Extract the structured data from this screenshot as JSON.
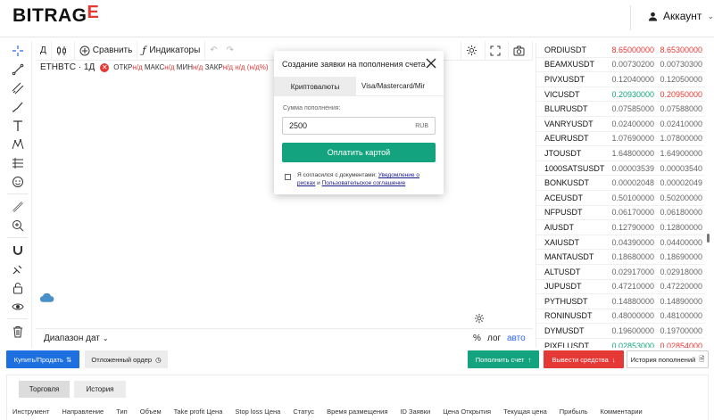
{
  "header": {
    "logo_main": "BITRAG",
    "logo_accent": "E",
    "account_label": "Аккаунт"
  },
  "toolbar": {
    "interval": "Д",
    "compare_label": "Сравнить",
    "indicators_label": "Индикаторы"
  },
  "legend": {
    "symbol": "ETHBTC · 1Д",
    "ohlc": [
      {
        "k": "ОТКР",
        "v": "н/д"
      },
      {
        "k": "МАКС",
        "v": "н/д"
      },
      {
        "k": "МИН",
        "v": "н/д"
      },
      {
        "k": "ЗАКР",
        "v": "н/д"
      },
      {
        "k": "",
        "v": "н/д (н/д%)"
      }
    ]
  },
  "chart_footer": {
    "range_label": "Диапазон дат",
    "percent": "%",
    "log": "лог",
    "auto": "авто"
  },
  "tickers": [
    {
      "symbol": "ORDIUSDT",
      "bid": "8.65000000",
      "ask": "8.65300000",
      "bid_color": "#e53935",
      "ask_color": "#e53935"
    },
    {
      "symbol": "BEAMXUSDT",
      "bid": "0.00730200",
      "ask": "0.00730300",
      "bid_color": "#666666",
      "ask_color": "#666666"
    },
    {
      "symbol": "PIVXUSDT",
      "bid": "0.12040000",
      "ask": "0.12050000",
      "bid_color": "#666666",
      "ask_color": "#666666"
    },
    {
      "symbol": "VICUSDT",
      "bid": "0.20930000",
      "ask": "0.20950000",
      "bid_color": "#14a37f",
      "ask_color": "#e53935"
    },
    {
      "symbol": "BLURUSDT",
      "bid": "0.07585000",
      "ask": "0.07588000",
      "bid_color": "#666666",
      "ask_color": "#666666"
    },
    {
      "symbol": "VANRYUSDT",
      "bid": "0.02400000",
      "ask": "0.02410000",
      "bid_color": "#666666",
      "ask_color": "#666666"
    },
    {
      "symbol": "AEURUSDT",
      "bid": "1.07690000",
      "ask": "1.07800000",
      "bid_color": "#666666",
      "ask_color": "#666666"
    },
    {
      "symbol": "JTOUSDT",
      "bid": "1.64800000",
      "ask": "1.64900000",
      "bid_color": "#666666",
      "ask_color": "#666666"
    },
    {
      "symbol": "1000SATSUSDT",
      "bid": "0.00003539",
      "ask": "0.00003540",
      "bid_color": "#666666",
      "ask_color": "#666666"
    },
    {
      "symbol": "BONKUSDT",
      "bid": "0.00002048",
      "ask": "0.00002049",
      "bid_color": "#666666",
      "ask_color": "#666666"
    },
    {
      "symbol": "ACEUSDT",
      "bid": "0.50100000",
      "ask": "0.50200000",
      "bid_color": "#666666",
      "ask_color": "#666666"
    },
    {
      "symbol": "NFPUSDT",
      "bid": "0.06170000",
      "ask": "0.06180000",
      "bid_color": "#666666",
      "ask_color": "#666666"
    },
    {
      "symbol": "AIUSDT",
      "bid": "0.12790000",
      "ask": "0.12800000",
      "bid_color": "#666666",
      "ask_color": "#666666"
    },
    {
      "symbol": "XAIUSDT",
      "bid": "0.04390000",
      "ask": "0.04400000",
      "bid_color": "#666666",
      "ask_color": "#666666"
    },
    {
      "symbol": "MANTAUSDT",
      "bid": "0.18680000",
      "ask": "0.18690000",
      "bid_color": "#666666",
      "ask_color": "#666666"
    },
    {
      "symbol": "ALTUSDT",
      "bid": "0.02917000",
      "ask": "0.02918000",
      "bid_color": "#666666",
      "ask_color": "#666666"
    },
    {
      "symbol": "JUPUSDT",
      "bid": "0.47210000",
      "ask": "0.47220000",
      "bid_color": "#666666",
      "ask_color": "#666666"
    },
    {
      "symbol": "PYTHUSDT",
      "bid": "0.14880000",
      "ask": "0.14890000",
      "bid_color": "#666666",
      "ask_color": "#666666"
    },
    {
      "symbol": "RONINUSDT",
      "bid": "0.48000000",
      "ask": "0.48100000",
      "bid_color": "#666666",
      "ask_color": "#666666"
    },
    {
      "symbol": "DYMUSDT",
      "bid": "0.19600000",
      "ask": "0.19700000",
      "bid_color": "#666666",
      "ask_color": "#666666"
    },
    {
      "symbol": "PIXELUSDT",
      "bid": "0.02853000",
      "ask": "0.02854000",
      "bid_color": "#14a37f",
      "ask_color": "#e53935"
    }
  ],
  "modal": {
    "title": "Создание заявки на пополнения счета",
    "tab_crypto": "Криптовалюты",
    "tab_card": "Visa/Mastercard/Mir",
    "amount_label": "Сумма пополнения:",
    "amount_value": "2500",
    "currency": "RUB",
    "pay_button": "Оплатить картой",
    "agree_prefix": "Я согласился с документами: ",
    "agree_link1": "Уведомление о рисках",
    "agree_and": " и ",
    "agree_link2": "Пользовательское соглашение"
  },
  "actions": {
    "buy_sell": "Купить/Продать",
    "pending_order": "Отложенный ордер",
    "deposit": "Пополнить счет",
    "withdraw": "Вывести средства",
    "deposit_history": "История пополнений"
  },
  "bottom": {
    "tab_trading": "Торговля",
    "tab_history": "История",
    "columns": [
      "Инструмент",
      "Направление",
      "Тип",
      "Объем",
      "Take profit Цена",
      "Stop loss Цена",
      "Статус",
      "Время размещения",
      "ID Заявки",
      "Цена Открытия",
      "Текущая цена",
      "Прибыль",
      "Комментарии"
    ]
  },
  "colors": {
    "accent_red": "#e53935",
    "accent_green": "#14a37f",
    "accent_blue": "#1e6fe0"
  }
}
